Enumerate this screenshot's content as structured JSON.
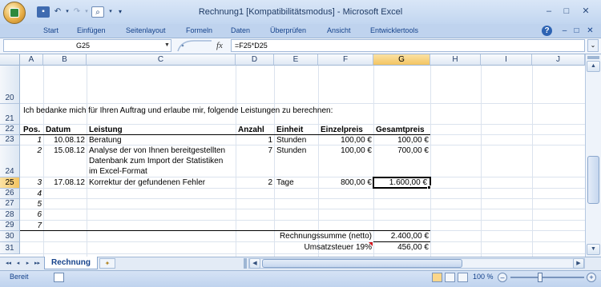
{
  "window": {
    "title": "Rechnung1  [Kompatibilitätsmodus]  -  Microsoft Excel",
    "controls": {
      "minimize": "–",
      "maximize": "□",
      "close": "✕"
    }
  },
  "quick_access": {
    "save_icon": "save-icon",
    "undo_icon": "undo-icon",
    "redo_icon": "redo-icon",
    "print_preview_icon": "print-preview-icon",
    "customize": "▾"
  },
  "ribbon": {
    "tabs": [
      "Start",
      "Einfügen",
      "Seitenlayout",
      "Formeln",
      "Daten",
      "Überprüfen",
      "Ansicht",
      "Entwicklertools"
    ],
    "help": "?",
    "doc_controls": {
      "minimize": "–",
      "restore": "□",
      "close": "✕"
    }
  },
  "formula_bar": {
    "name_box": "G25",
    "fx": "fx",
    "formula": "=F25*D25",
    "expand": "⌄"
  },
  "columns": [
    "A",
    "B",
    "C",
    "D",
    "E",
    "F",
    "G",
    "H",
    "I",
    "J"
  ],
  "selected_column": "G",
  "rows": [
    "20",
    "21",
    "22",
    "23",
    "24",
    "25",
    "26",
    "27",
    "28",
    "29",
    "30",
    "31"
  ],
  "selected_row": "25",
  "sheet": {
    "intro": "Ich bedanke mich für Ihren Auftrag und erlaube mir, folgende Leistungen zu berechnen:",
    "headers": {
      "pos": "Pos.",
      "datum": "Datum",
      "leistung": "Leistung",
      "anzahl": "Anzahl",
      "einheit": "Einheit",
      "einzelpreis": "Einzelpreis",
      "gesamtpreis": "Gesamtpreis"
    },
    "items": [
      {
        "pos": "1",
        "datum": "10.08.12",
        "leistung": "Beratung",
        "anzahl": "1",
        "einheit": "Stunden",
        "einzelpreis": "100,00 €",
        "gesamtpreis": "100,00 €"
      },
      {
        "pos": "2",
        "datum": "15.08.12",
        "leistung_lines": [
          "Analyse der von Ihnen bereitgestellten",
          "Datenbank zum Import der Statistiken",
          "im Excel-Format"
        ],
        "anzahl": "7",
        "einheit": "Stunden",
        "einzelpreis": "100,00 €",
        "gesamtpreis": "700,00 €"
      },
      {
        "pos": "3",
        "datum": "17.08.12",
        "leistung": "Korrektur der gefundenen Fehler",
        "anzahl": "2",
        "einheit": "Tage",
        "einzelpreis": "800,00 €",
        "gesamtpreis": "1.600,00 €"
      }
    ],
    "empty_positions": [
      "4",
      "5",
      "6",
      "7"
    ],
    "summary": {
      "netto_label": "Rechnungssumme (netto)",
      "netto_value": "2.400,00 €",
      "ust_label": "Umsatzsteuer 19%",
      "ust_value": "456,00 €"
    }
  },
  "sheet_tabs": {
    "active": "Rechnung",
    "nav": [
      "◂◂",
      "◂",
      "▸",
      "▸▸"
    ]
  },
  "status": {
    "ready": "Bereit",
    "zoom": "100 %",
    "zoom_level": 1.0,
    "zoom_out": "–",
    "zoom_in": "+"
  }
}
